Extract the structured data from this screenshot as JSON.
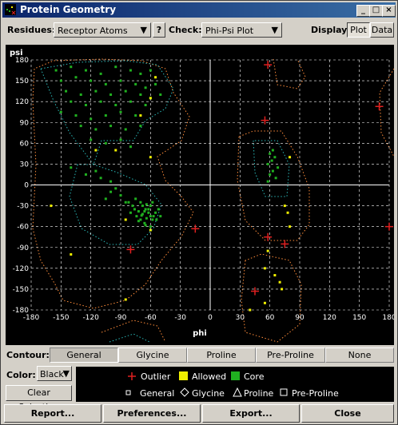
{
  "window": {
    "title": "Protein Geometry"
  },
  "toolbar": {
    "residues_label": "Residues:",
    "residues_value": "Receptor Atoms",
    "help_label": "?",
    "check_label": "Check:",
    "check_value": "Phi-Psi Plot",
    "display_label": "Display:",
    "plot_label": "Plot",
    "data_label": "Data"
  },
  "contour": {
    "label": "Contour:",
    "tabs": [
      "General",
      "Glycine",
      "Proline",
      "Pre-Proline",
      "None"
    ],
    "selected": "General"
  },
  "color": {
    "label": "Color:",
    "value": "Black"
  },
  "clear_selection_label": "Clear Selection",
  "legend": {
    "outlier": "Outlier",
    "allowed": "Allowed",
    "core": "Core",
    "general": "General",
    "glycine": "Glycine",
    "proline": "Proline",
    "preproline": "Pre-Proline",
    "colors": {
      "outlier": "#e02020",
      "allowed": "#f0f000",
      "core": "#20b020"
    }
  },
  "footer": {
    "report": "Report...",
    "preferences": "Preferences...",
    "export": "Export...",
    "close": "Close"
  },
  "chart_data": {
    "type": "scatter",
    "xlabel": "phi",
    "ylabel": "psi",
    "xlim": [
      -180,
      180
    ],
    "ylim": [
      -180,
      180
    ],
    "ticks": [
      -180,
      -150,
      -120,
      -90,
      -60,
      -30,
      0,
      30,
      60,
      90,
      120,
      150,
      180
    ],
    "grid": true,
    "series": [
      {
        "name": "Core",
        "color": "#20b020",
        "points": [
          [
            -155,
            165
          ],
          [
            -140,
            170
          ],
          [
            -125,
            165
          ],
          [
            -110,
            160
          ],
          [
            -95,
            170
          ],
          [
            -80,
            165
          ],
          [
            -70,
            160
          ],
          [
            -60,
            165
          ],
          [
            -150,
            150
          ],
          [
            -135,
            155
          ],
          [
            -120,
            150
          ],
          [
            -105,
            145
          ],
          [
            -90,
            150
          ],
          [
            -75,
            145
          ],
          [
            -65,
            140
          ],
          [
            -55,
            145
          ],
          [
            -145,
            135
          ],
          [
            -130,
            130
          ],
          [
            -115,
            135
          ],
          [
            -100,
            130
          ],
          [
            -85,
            135
          ],
          [
            -70,
            130
          ],
          [
            -60,
            125
          ],
          [
            -50,
            130
          ],
          [
            -140,
            120
          ],
          [
            -125,
            115
          ],
          [
            -110,
            120
          ],
          [
            -95,
            115
          ],
          [
            -80,
            120
          ],
          [
            -65,
            115
          ],
          [
            -150,
            105
          ],
          [
            -135,
            100
          ],
          [
            -120,
            95
          ],
          [
            -105,
            100
          ],
          [
            -90,
            105
          ],
          [
            -75,
            100
          ],
          [
            -130,
            85
          ],
          [
            -115,
            80
          ],
          [
            -100,
            85
          ],
          [
            -85,
            80
          ],
          [
            -70,
            85
          ],
          [
            -120,
            65
          ],
          [
            -105,
            60
          ],
          [
            -90,
            65
          ],
          [
            -80,
            55
          ],
          [
            -140,
            25
          ],
          [
            -125,
            15
          ],
          [
            -110,
            10
          ],
          [
            -100,
            5
          ],
          [
            -95,
            -5
          ],
          [
            -90,
            -15
          ],
          [
            -85,
            -25
          ],
          [
            -100,
            -10
          ],
          [
            -115,
            20
          ],
          [
            -105,
            -20
          ],
          [
            -75,
            -20
          ],
          [
            -70,
            -25
          ],
          [
            -68,
            -30
          ],
          [
            -65,
            -35
          ],
          [
            -62,
            -40
          ],
          [
            -60,
            -45
          ],
          [
            -58,
            -50
          ],
          [
            -72,
            -38
          ],
          [
            -68,
            -42
          ],
          [
            -64,
            -48
          ],
          [
            -60,
            -30
          ],
          [
            -55,
            -40
          ],
          [
            -78,
            -30
          ],
          [
            -74,
            -45
          ],
          [
            -66,
            -55
          ],
          [
            -62,
            -35
          ],
          [
            -57,
            -45
          ],
          [
            -70,
            -50
          ],
          [
            -80,
            -40
          ],
          [
            -52,
            -35
          ],
          [
            -76,
            -35
          ],
          [
            -64,
            -28
          ],
          [
            -58,
            -25
          ],
          [
            -69,
            -44
          ],
          [
            -65,
            -58
          ],
          [
            -60,
            -60
          ],
          [
            -54,
            -50
          ],
          [
            -82,
            -25
          ],
          [
            -50,
            -45
          ],
          [
            -72,
            -52
          ],
          [
            -66,
            -38
          ],
          [
            60,
            45
          ],
          [
            65,
            40
          ],
          [
            62,
            35
          ],
          [
            58,
            30
          ],
          [
            68,
            25
          ],
          [
            63,
            20
          ],
          [
            60,
            15
          ],
          [
            66,
            10
          ],
          [
            58,
            5
          ],
          [
            63,
            50
          ]
        ]
      },
      {
        "name": "Allowed",
        "color": "#f0f000",
        "points": [
          [
            -55,
            155
          ],
          [
            -60,
            125
          ],
          [
            -70,
            100
          ],
          [
            -115,
            50
          ],
          [
            -95,
            50
          ],
          [
            -60,
            40
          ],
          [
            -85,
            -50
          ],
          [
            -60,
            -65
          ],
          [
            -160,
            -30
          ],
          [
            -140,
            -100
          ],
          [
            -85,
            -165
          ],
          [
            80,
            40
          ],
          [
            75,
            -30
          ],
          [
            78,
            -40
          ],
          [
            80,
            -60
          ],
          [
            65,
            -130
          ],
          [
            70,
            -140
          ],
          [
            72,
            -150
          ],
          [
            55,
            -120
          ],
          [
            55,
            -170
          ],
          [
            40,
            -180
          ],
          [
            58,
            -95
          ]
        ]
      },
      {
        "name": "Outlier",
        "color": "#e02020",
        "points": [
          [
            58,
            173
          ],
          [
            170,
            113
          ],
          [
            55,
            93
          ],
          [
            -15,
            -63
          ],
          [
            180,
            -60
          ],
          [
            58,
            -75
          ],
          [
            75,
            -85
          ],
          [
            -80,
            -93
          ],
          [
            45,
            -153
          ]
        ]
      }
    ]
  }
}
